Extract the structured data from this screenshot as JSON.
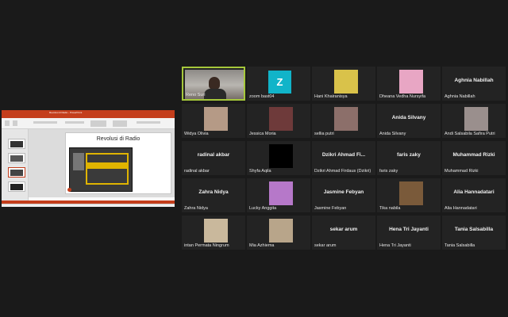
{
  "share": {
    "window_title": "Revolusi di Radio - PowerPoint",
    "slide_title": "Revolusi di Radio"
  },
  "participants": [
    {
      "name": "Reno Suri",
      "label": "",
      "tile": "video"
    },
    {
      "name": "zoom bast04",
      "label": "",
      "tile": "avatar",
      "initial": "Z"
    },
    {
      "name": "Hani Khairanisya",
      "label": "",
      "tile": "photo",
      "color": "#d9c24a"
    },
    {
      "name": "Dheana Vedha Nursyifa",
      "label": "",
      "tile": "photo",
      "color": "#e8a6c4"
    },
    {
      "name": "Aghnia Nabillah",
      "label": "Aghnia Nabillah",
      "tile": "name"
    },
    {
      "name": "Widya Olivia",
      "label": "",
      "tile": "photo",
      "color": "#b59a86"
    },
    {
      "name": "Jessica Moria",
      "label": "",
      "tile": "photo",
      "color": "#6e3a3a"
    },
    {
      "name": "sellia putri",
      "label": "",
      "tile": "photo",
      "color": "#8c6f6a"
    },
    {
      "name": "Anida Silvany",
      "label": "Anida Silvany",
      "tile": "name"
    },
    {
      "name": "Andi Salsabila Safira Putri",
      "label": "",
      "tile": "photo",
      "color": "#9a8f8d"
    },
    {
      "name": "radinal akbar",
      "label": "radinal akbar",
      "tile": "name"
    },
    {
      "name": "Shyfa Aqila",
      "label": "",
      "tile": "black"
    },
    {
      "name": "Dzikri Ahmad Firdaus (Dzikri)",
      "label": "Dzikri Ahmad Fi...",
      "tile": "name"
    },
    {
      "name": "faris zaky",
      "label": "faris zaky",
      "tile": "name"
    },
    {
      "name": "Muhammad Rizki",
      "label": "Muhammad Rizki",
      "tile": "name"
    },
    {
      "name": "Zahra Nidya",
      "label": "Zahra Nidya",
      "tile": "name"
    },
    {
      "name": "Lucky Anggita",
      "label": "",
      "tile": "photo",
      "color": "#b678c9"
    },
    {
      "name": "Jasmine Febyan",
      "label": "Jasmine Febyan",
      "tile": "name"
    },
    {
      "name": "Tika nabila",
      "label": "",
      "tile": "photo",
      "color": "#7a5a3a"
    },
    {
      "name": "Alia Hannadatari",
      "label": "Alia Hannadatari",
      "tile": "name"
    },
    {
      "name": "intan Permata Ningrum",
      "label": "",
      "tile": "photo",
      "color": "#c9b89c"
    },
    {
      "name": "Mia Azhiema",
      "label": "",
      "tile": "photo",
      "color": "#b8a58a"
    },
    {
      "name": "sekar arum",
      "label": "sekar arum",
      "tile": "name"
    },
    {
      "name": "Hena Tri Jayanti",
      "label": "Hena Tri Jayanti",
      "tile": "name"
    },
    {
      "name": "Tania Salsabilla",
      "label": "Tania Salsabilla",
      "tile": "name"
    }
  ],
  "colors": {
    "background": "#1a1a1a",
    "tile": "#232323",
    "active_speaker_border": "#a6c83b",
    "ppt_accent": "#c43e1c",
    "poster_gold": "#e0b400"
  }
}
